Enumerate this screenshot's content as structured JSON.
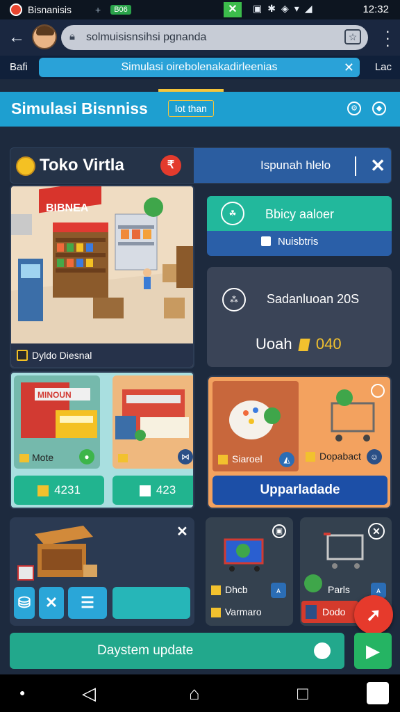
{
  "status_bar": {
    "app_title": "Bisnanisis",
    "badge": "B06",
    "time": "12:32"
  },
  "browser": {
    "url": "solmuisisnsihsi pgnanda"
  },
  "banner": {
    "left": "Bafi",
    "text": "Simulasi oirebolenakadirleenias",
    "right": "Lac"
  },
  "app_header": {
    "title": "Simulasi Bisnniss",
    "tab": "lot than"
  },
  "toko_bar": {
    "title": "Toko Virtla",
    "right_label": "Ispunah hlelo"
  },
  "store_card": {
    "sign": "BIBNEA",
    "footer_label": "Dyldo Diesnal"
  },
  "card_teal": {
    "title": "Bbicy aaloer",
    "subtitle": "Nuisbtris"
  },
  "card_dark": {
    "title": "Sadanluoan 20S",
    "value_prefix": "Uoah",
    "value": "040"
  },
  "store_board": {
    "mini1_sign": "MINOUN",
    "mini1_label": "Mote",
    "mini2_label": "",
    "price1": "4231",
    "price2": "423"
  },
  "orange_panel": {
    "left_label": "Siaroel",
    "right_label": "Dopabact",
    "button": "Upparladade"
  },
  "bottom_cards": {
    "card1_row1": "Dhcb",
    "card1_row2": "Varmaro",
    "card2_label": "Parls",
    "card2_btn": "Dodo"
  },
  "system_update": {
    "label": "Daystem update"
  },
  "colors": {
    "accent": "#1e9fd0",
    "teal": "#22b89c",
    "danger": "#e63a2c",
    "upgrade": "#1c4fa7"
  }
}
